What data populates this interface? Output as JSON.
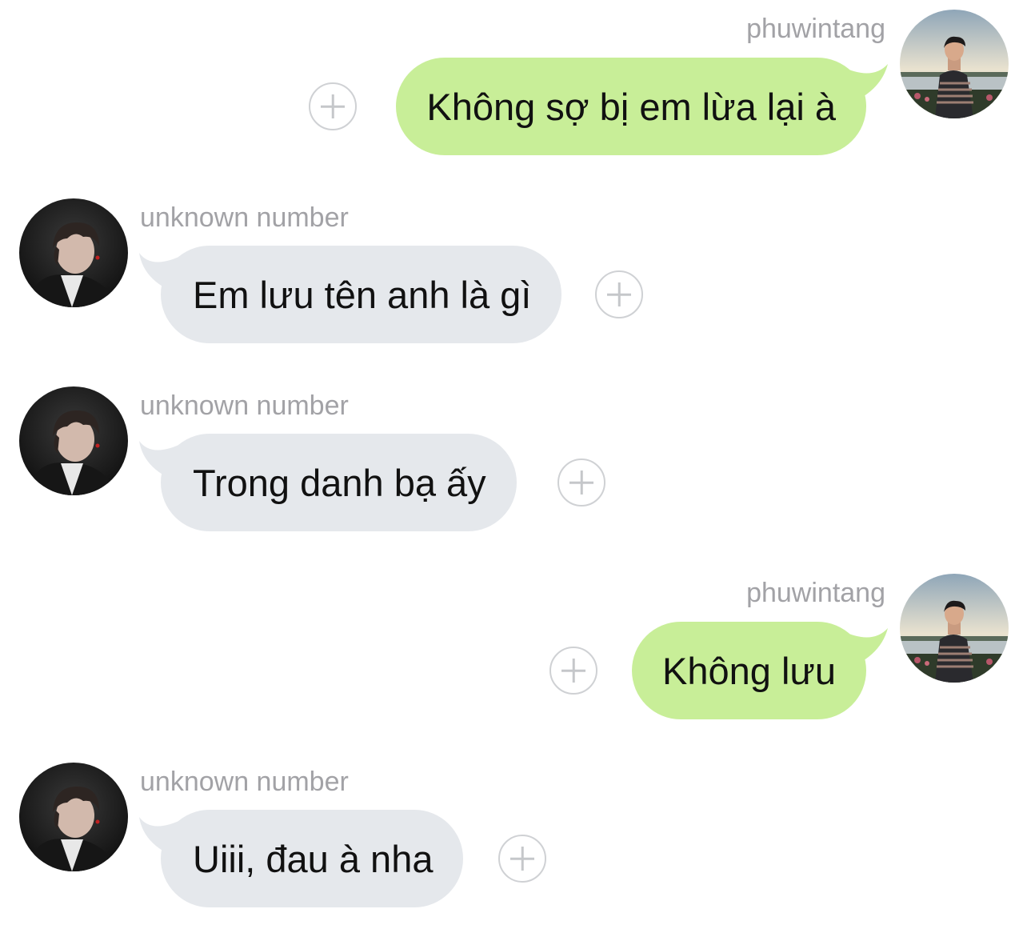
{
  "messages": [
    {
      "direction": "outgoing",
      "sender": "phuwintang",
      "text": "Không sợ bị em lừa lại à"
    },
    {
      "direction": "incoming",
      "sender": "unknown number",
      "text": "Em lưu tên anh là gì"
    },
    {
      "direction": "incoming",
      "sender": "unknown number",
      "text": "Trong danh bạ ấy"
    },
    {
      "direction": "outgoing",
      "sender": "phuwintang",
      "text": "Không lưu"
    },
    {
      "direction": "incoming",
      "sender": "unknown number",
      "text": "Uiii, đau à nha"
    }
  ],
  "icons": {
    "reaction_button": "add-reaction-icon",
    "avatar": "profile-photo"
  },
  "colors": {
    "outgoing_bubble": "#c8ee98",
    "incoming_bubble": "#e5e8ec",
    "sender_name": "#a2a2a6",
    "reaction_button_border": "#cfd1d4"
  }
}
